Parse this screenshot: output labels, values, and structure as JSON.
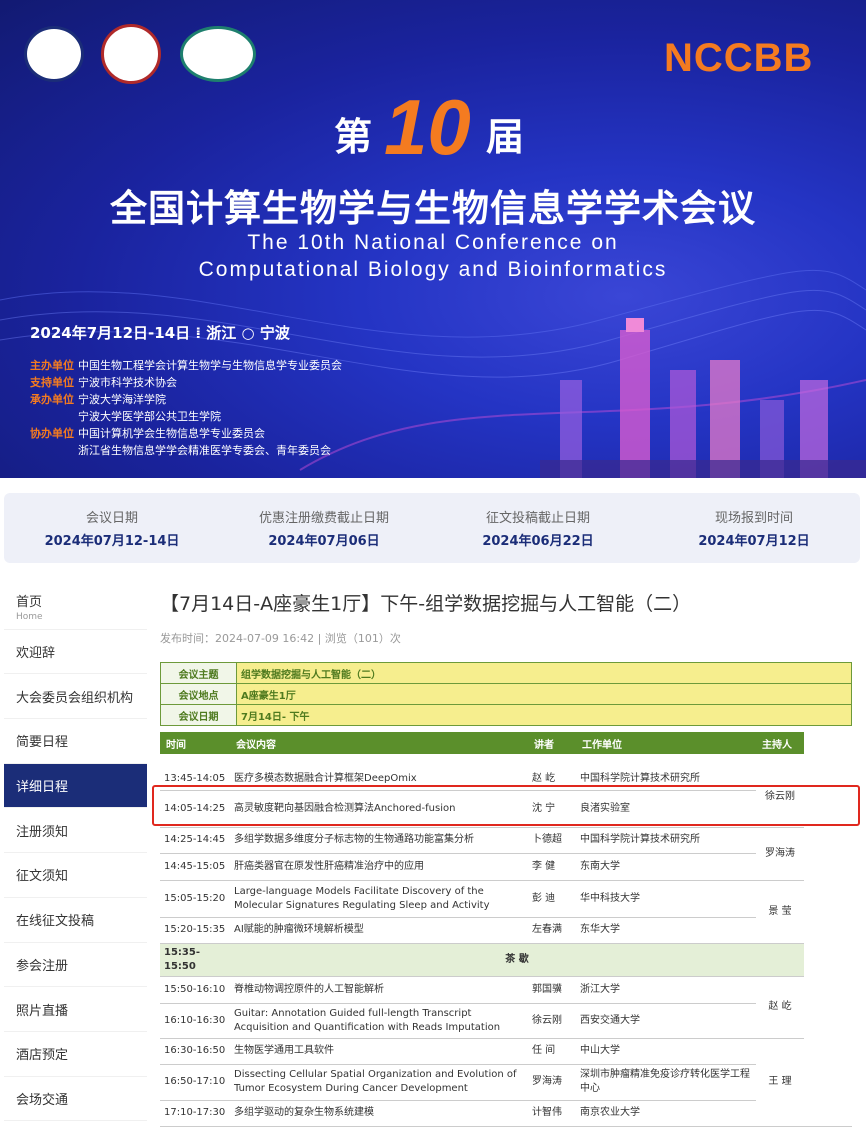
{
  "banner": {
    "brand": "NCCBB",
    "title_prefix": "第",
    "title_number": "10",
    "title_suffix": "届",
    "title_cn": "全国计算生物学与生物信息学学术会议",
    "title_en_line1": "The 10th National Conference on",
    "title_en_line2": "Computational Biology and Bioinformatics",
    "date_place": "2024年7月12日-14日  ⁞  浙江 ○ 宁波",
    "orgs": [
      {
        "k": "主办单位",
        "v": [
          "中国生物工程学会计算生物学与生物信息学专业委员会"
        ]
      },
      {
        "k": "支持单位",
        "v": [
          "宁波市科学技术协会"
        ]
      },
      {
        "k": "承办单位",
        "v": [
          "宁波大学海洋学院",
          "宁波大学医学部公共卫生学院"
        ]
      },
      {
        "k": "协办单位",
        "v": [
          "中国计算机学会生物信息学专业委员会",
          "浙江省生物信息学学会精准医学专委会、青年委员会"
        ]
      }
    ]
  },
  "dates": [
    {
      "label": "会议日期",
      "value": "2024年07月12-14日"
    },
    {
      "label": "优惠注册缴费截止日期",
      "value": "2024年07月06日"
    },
    {
      "label": "征文投稿截止日期",
      "value": "2024年06月22日"
    },
    {
      "label": "现场报到时间",
      "value": "2024年07月12日"
    }
  ],
  "sidebar": [
    {
      "label": "首页",
      "sub": "Home"
    },
    {
      "label": "欢迎辞"
    },
    {
      "label": "大会委员会组织机构"
    },
    {
      "label": "简要日程"
    },
    {
      "label": "详细日程",
      "active": true
    },
    {
      "label": "注册须知"
    },
    {
      "label": "征文须知"
    },
    {
      "label": "在线征文投稿"
    },
    {
      "label": "参会注册"
    },
    {
      "label": "照片直播"
    },
    {
      "label": "酒店预定"
    },
    {
      "label": "会场交通"
    }
  ],
  "page": {
    "title": "【7月14日-A座豪生1厅】下午-组学数据挖掘与人工智能（二）",
    "meta": "发布时间：2024-07-09 16:42 | 浏览（101）次"
  },
  "meeting": [
    {
      "k": "会议主题",
      "v": "组学数据挖掘与人工智能（二）"
    },
    {
      "k": "会议地点",
      "v": "A座豪生1厅"
    },
    {
      "k": "会议日期",
      "v": "7月14日- 下午"
    }
  ],
  "schedule_headers": [
    "时间",
    "会议内容",
    "讲者",
    "工作单位",
    "主持人"
  ],
  "schedule": [
    {
      "time": "13:45-14:05",
      "topic": "医疗多模态数据融合计算框架DeepOmix",
      "speaker": "赵 屹",
      "unit": "中国科学院计算技术研究所"
    },
    {
      "time": "14:05-14:25",
      "topic": "高灵敏度靶向基因融合检测算法Anchored-fusion",
      "speaker": "沈 宁",
      "unit": "良渚实验室"
    },
    {
      "time": "14:25-14:45",
      "topic": "多组学数据多维度分子标志物的生物通路功能富集分析",
      "speaker": "卜德超",
      "unit": "中国科学院计算技术研究所"
    },
    {
      "time": "14:45-15:05",
      "topic": "肝癌类器官在原发性肝癌精准治疗中的应用",
      "speaker": "李 健",
      "unit": "东南大学"
    },
    {
      "time": "15:05-15:20",
      "topic": "Large-language Models Facilitate Discovery of the Molecular Signatures Regulating Sleep and Activity",
      "speaker": "彭 迪",
      "unit": "华中科技大学"
    },
    {
      "time": "15:20-15:35",
      "topic": "AI赋能的肿瘤微环境解析模型",
      "speaker": "左春满",
      "unit": "东华大学"
    },
    {
      "time": "15:35-15:50",
      "topic": "茶 歇",
      "speaker": "",
      "unit": "",
      "break": true
    },
    {
      "time": "15:50-16:10",
      "topic": "脊椎动物调控原件的人工智能解析",
      "speaker": "郭国骥",
      "unit": "浙江大学"
    },
    {
      "time": "16:10-16:30",
      "topic": "Guitar: Annotation Guided full-length Transcript Acquisition and Quantification with Reads Imputation",
      "speaker": "徐云刚",
      "unit": "西安交通大学"
    },
    {
      "time": "16:30-16:50",
      "topic": "生物医学通用工具软件",
      "speaker": "任 间",
      "unit": "中山大学"
    },
    {
      "time": "16:50-17:10",
      "topic": "Dissecting Cellular Spatial Organization and Evolution of Tumor Ecosystem During Cancer Development",
      "speaker": "罗海涛",
      "unit": "深圳市肿瘤精准免疫诊疗转化医学工程中心"
    },
    {
      "time": "17:10-17:30",
      "topic": "多组学驱动的复杂生物系统建模",
      "speaker": "计智伟",
      "unit": "南京农业大学"
    }
  ],
  "hosts": [
    "徐云刚",
    "罗海涛",
    "景 莹",
    "赵 屹",
    "王 理"
  ]
}
